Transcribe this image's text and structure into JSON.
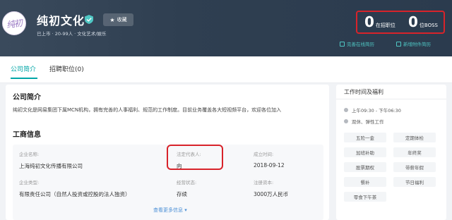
{
  "header": {
    "logo_text": "纯初",
    "company_name": "纯初文化",
    "follow_label": "收藏",
    "tags": "已上市 · 20-99人 · 文化艺术/娱乐",
    "stats": [
      {
        "value": "0",
        "label": "在招职位"
      },
      {
        "value": "0",
        "label": "位BOSS"
      }
    ],
    "links": [
      "完善在线简历",
      "新增附件简历"
    ]
  },
  "tabs": [
    {
      "label": "公司简介",
      "active": true
    },
    {
      "label": "招聘职位(0)",
      "active": false
    }
  ],
  "intro": {
    "title": "公司简介",
    "text": "纯初文化是网易集团下属MCN机构，拥有完善的人事福利、规范的工作制度。目前业务覆盖各大短视频平台，欢迎各位加入"
  },
  "business": {
    "title": "工商信息",
    "fields": [
      {
        "key": "企业名称:",
        "value": "上海纯初文化传播有限公司"
      },
      {
        "key": "法定代表人:",
        "value": "向"
      },
      {
        "key": "成立时间:",
        "value": "2018-09-12"
      },
      {
        "key": "企业类型:",
        "value": "有限责任公司（自然人投资或控股的法人独资）"
      },
      {
        "key": "经营状态:",
        "value": "存续"
      },
      {
        "key": "注册资本:",
        "value": "3000万人民币"
      }
    ],
    "more_label": "查看更多信息"
  },
  "sidebar": {
    "title": "工作时间及福利",
    "hours": "上午09:30 - 下午06:30",
    "rest": "双休、弹性工作",
    "perks": [
      "五险一金",
      "定期体检",
      "加班补助",
      "年终奖",
      "股票期权",
      "带薪年假",
      "餐补",
      "节日福利",
      "零食下午茶"
    ]
  },
  "colors": {
    "accent": "#00a6a7",
    "highlight": "#d8232a",
    "banner": "#2f3f51"
  }
}
